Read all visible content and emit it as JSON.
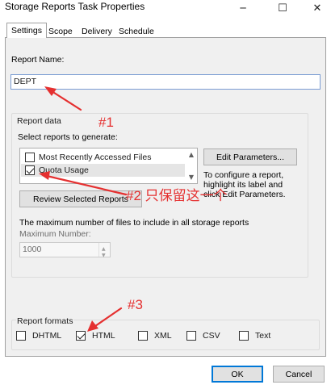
{
  "window": {
    "title": "Storage Reports Task Properties",
    "minimize_glyph": "─",
    "maximize_glyph": "☐",
    "close_glyph": "✕"
  },
  "tabs": [
    {
      "label": "Settings",
      "active": true
    },
    {
      "label": "Scope",
      "active": false
    },
    {
      "label": "Delivery",
      "active": false
    },
    {
      "label": "Schedule",
      "active": false
    }
  ],
  "settings": {
    "report_name_label": "Report Name:",
    "report_name_value": "DEPT",
    "report_data_title": "Report data",
    "select_reports_label": "Select reports to generate:",
    "reports": [
      {
        "label": "Most Recently Accessed Files",
        "checked": false,
        "selected": false
      },
      {
        "label": "Quota Usage",
        "checked": true,
        "selected": true
      }
    ],
    "edit_parameters_button": "Edit Parameters...",
    "help_text_lines": [
      "To configure a report,",
      "highlight its label and",
      "click Edit Parameters."
    ],
    "review_button": "Review Selected Reports",
    "max_files_text": "The maximum number of files to include in all storage reports",
    "max_number_label": "Maximum Number:",
    "max_number_value": "1000",
    "report_formats_title": "Report formats",
    "formats": [
      {
        "label": "DHTML",
        "checked": false
      },
      {
        "label": "HTML",
        "checked": true
      },
      {
        "label": "XML",
        "checked": false
      },
      {
        "label": "CSV",
        "checked": false
      },
      {
        "label": "Text",
        "checked": false
      }
    ]
  },
  "footer": {
    "ok_button": "OK",
    "cancel_button": "Cancel"
  },
  "annotations": {
    "anno1": "#1",
    "anno2": "#2 只保留这一个",
    "anno3": "#3",
    "color": "#e53030"
  }
}
